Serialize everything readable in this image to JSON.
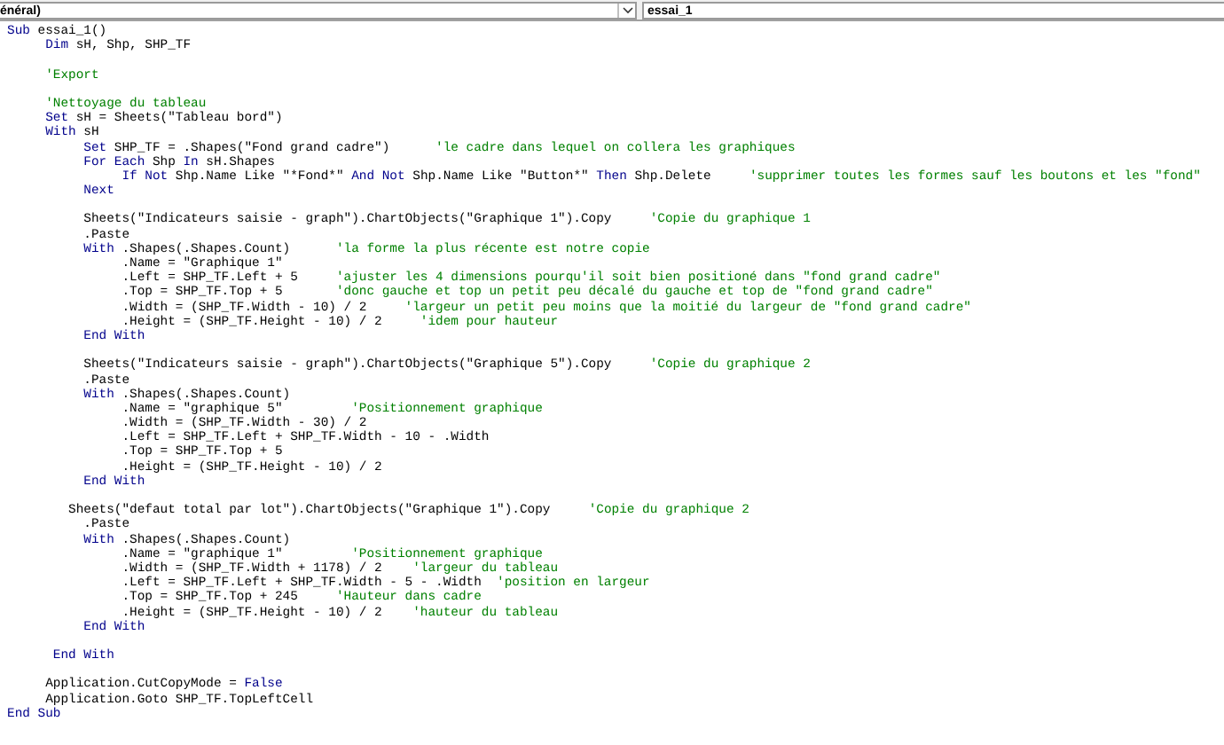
{
  "toolbar": {
    "object_box": {
      "value": "énéral)"
    },
    "procedure_box": {
      "value": "essai_1"
    }
  },
  "code_lines": [
    {
      "kind": "code",
      "parts": [
        {
          "kind": "keyword",
          "text": "Sub"
        },
        {
          "kind": "plain",
          "text": " essai_1()"
        }
      ]
    },
    {
      "kind": "code",
      "parts": [
        {
          "kind": "keyword",
          "text": "     Dim"
        },
        {
          "kind": "plain",
          "text": " sH, Shp, SHP_TF"
        }
      ]
    },
    {
      "kind": "blank"
    },
    {
      "kind": "code",
      "parts": [
        {
          "kind": "comment",
          "text": "     'Export"
        }
      ]
    },
    {
      "kind": "blank"
    },
    {
      "kind": "code",
      "parts": [
        {
          "kind": "comment",
          "text": "     'Nettoyage du tableau"
        }
      ]
    },
    {
      "kind": "code",
      "parts": [
        {
          "kind": "keyword",
          "text": "     Set"
        },
        {
          "kind": "plain",
          "text": " sH = Sheets(\"Tableau bord\")"
        }
      ]
    },
    {
      "kind": "code",
      "parts": [
        {
          "kind": "keyword",
          "text": "     With"
        },
        {
          "kind": "plain",
          "text": " sH"
        }
      ]
    },
    {
      "kind": "code",
      "parts": [
        {
          "kind": "keyword",
          "text": "          Set"
        },
        {
          "kind": "plain",
          "text": " SHP_TF = .Shapes(\"Fond grand cadre\")      "
        },
        {
          "kind": "comment",
          "text": "'le cadre dans lequel on collera les graphiques"
        }
      ]
    },
    {
      "kind": "code",
      "parts": [
        {
          "kind": "keyword",
          "text": "          For Each"
        },
        {
          "kind": "plain",
          "text": " Shp "
        },
        {
          "kind": "keyword",
          "text": "In"
        },
        {
          "kind": "plain",
          "text": " sH.Shapes"
        }
      ]
    },
    {
      "kind": "code",
      "parts": [
        {
          "kind": "keyword",
          "text": "               If Not"
        },
        {
          "kind": "plain",
          "text": " Shp.Name Like \"*Fond*\" "
        },
        {
          "kind": "keyword",
          "text": "And Not"
        },
        {
          "kind": "plain",
          "text": " Shp.Name Like \"Button*\" "
        },
        {
          "kind": "keyword",
          "text": "Then"
        },
        {
          "kind": "plain",
          "text": " Shp.Delete     "
        },
        {
          "kind": "comment",
          "text": "'supprimer toutes les formes sauf les boutons et les \"fond\""
        }
      ]
    },
    {
      "kind": "code",
      "parts": [
        {
          "kind": "keyword",
          "text": "          Next"
        }
      ]
    },
    {
      "kind": "blank"
    },
    {
      "kind": "code",
      "parts": [
        {
          "kind": "plain",
          "text": "          Sheets(\"Indicateurs saisie - graph\").ChartObjects(\"Graphique 1\").Copy     "
        },
        {
          "kind": "comment",
          "text": "'Copie du graphique 1"
        }
      ]
    },
    {
      "kind": "code",
      "parts": [
        {
          "kind": "plain",
          "text": "          .Paste"
        }
      ]
    },
    {
      "kind": "code",
      "parts": [
        {
          "kind": "keyword",
          "text": "          With"
        },
        {
          "kind": "plain",
          "text": " .Shapes(.Shapes.Count)      "
        },
        {
          "kind": "comment",
          "text": "'la forme la plus récente est notre copie"
        }
      ]
    },
    {
      "kind": "code",
      "parts": [
        {
          "kind": "plain",
          "text": "               .Name = \"Graphique 1\""
        }
      ]
    },
    {
      "kind": "code",
      "parts": [
        {
          "kind": "plain",
          "text": "               .Left = SHP_TF.Left + 5     "
        },
        {
          "kind": "comment",
          "text": "'ajuster les 4 dimensions pourqu'il soit bien positioné dans \"fond grand cadre\""
        }
      ]
    },
    {
      "kind": "code",
      "parts": [
        {
          "kind": "plain",
          "text": "               .Top = SHP_TF.Top + 5       "
        },
        {
          "kind": "comment",
          "text": "'donc gauche et top un petit peu décalé du gauche et top de \"fond grand cadre\""
        }
      ]
    },
    {
      "kind": "code",
      "parts": [
        {
          "kind": "plain",
          "text": "               .Width = (SHP_TF.Width - 10) / 2     "
        },
        {
          "kind": "comment",
          "text": "'largeur un petit peu moins que la moitié du largeur de \"fond grand cadre\""
        }
      ]
    },
    {
      "kind": "code",
      "parts": [
        {
          "kind": "plain",
          "text": "               .Height = (SHP_TF.Height - 10) / 2     "
        },
        {
          "kind": "comment",
          "text": "'idem pour hauteur"
        }
      ]
    },
    {
      "kind": "code",
      "parts": [
        {
          "kind": "keyword",
          "text": "          End With"
        }
      ]
    },
    {
      "kind": "blank"
    },
    {
      "kind": "code",
      "parts": [
        {
          "kind": "plain",
          "text": "          Sheets(\"Indicateurs saisie - graph\").ChartObjects(\"Graphique 5\").Copy     "
        },
        {
          "kind": "comment",
          "text": "'Copie du graphique 2"
        }
      ]
    },
    {
      "kind": "code",
      "parts": [
        {
          "kind": "plain",
          "text": "          .Paste"
        }
      ]
    },
    {
      "kind": "code",
      "parts": [
        {
          "kind": "keyword",
          "text": "          With"
        },
        {
          "kind": "plain",
          "text": " .Shapes(.Shapes.Count)"
        }
      ]
    },
    {
      "kind": "code",
      "parts": [
        {
          "kind": "plain",
          "text": "               .Name = \"graphique 5\"         "
        },
        {
          "kind": "comment",
          "text": "'Positionnement graphique"
        }
      ]
    },
    {
      "kind": "code",
      "parts": [
        {
          "kind": "plain",
          "text": "               .Width = (SHP_TF.Width - 30) / 2"
        }
      ]
    },
    {
      "kind": "code",
      "parts": [
        {
          "kind": "plain",
          "text": "               .Left = SHP_TF.Left + SHP_TF.Width - 10 - .Width"
        }
      ]
    },
    {
      "kind": "code",
      "parts": [
        {
          "kind": "plain",
          "text": "               .Top = SHP_TF.Top + 5"
        }
      ]
    },
    {
      "kind": "code",
      "parts": [
        {
          "kind": "plain",
          "text": "               .Height = (SHP_TF.Height - 10) / 2"
        }
      ]
    },
    {
      "kind": "code",
      "parts": [
        {
          "kind": "keyword",
          "text": "          End With"
        }
      ]
    },
    {
      "kind": "blank"
    },
    {
      "kind": "code",
      "parts": [
        {
          "kind": "plain",
          "text": "        Sheets(\"defaut total par lot\").ChartObjects(\"Graphique 1\").Copy     "
        },
        {
          "kind": "comment",
          "text": "'Copie du graphique 2"
        }
      ]
    },
    {
      "kind": "code",
      "parts": [
        {
          "kind": "plain",
          "text": "          .Paste"
        }
      ]
    },
    {
      "kind": "code",
      "parts": [
        {
          "kind": "keyword",
          "text": "          With"
        },
        {
          "kind": "plain",
          "text": " .Shapes(.Shapes.Count)"
        }
      ]
    },
    {
      "kind": "code",
      "parts": [
        {
          "kind": "plain",
          "text": "               .Name = \"graphique 1\"         "
        },
        {
          "kind": "comment",
          "text": "'Positionnement graphique"
        }
      ]
    },
    {
      "kind": "code",
      "parts": [
        {
          "kind": "plain",
          "text": "               .Width = (SHP_TF.Width + 1178) / 2    "
        },
        {
          "kind": "comment",
          "text": "'largeur du tableau"
        }
      ]
    },
    {
      "kind": "code",
      "parts": [
        {
          "kind": "plain",
          "text": "               .Left = SHP_TF.Left + SHP_TF.Width - 5 - .Width  "
        },
        {
          "kind": "comment",
          "text": "'position en largeur"
        }
      ]
    },
    {
      "kind": "code",
      "parts": [
        {
          "kind": "plain",
          "text": "               .Top = SHP_TF.Top + 245     "
        },
        {
          "kind": "comment",
          "text": "'Hauteur dans cadre"
        }
      ]
    },
    {
      "kind": "code",
      "parts": [
        {
          "kind": "plain",
          "text": "               .Height = (SHP_TF.Height - 10) / 2    "
        },
        {
          "kind": "comment",
          "text": "'hauteur du tableau"
        }
      ]
    },
    {
      "kind": "code",
      "parts": [
        {
          "kind": "keyword",
          "text": "          End With"
        }
      ]
    },
    {
      "kind": "blank"
    },
    {
      "kind": "code",
      "parts": [
        {
          "kind": "keyword",
          "text": "      End With"
        }
      ]
    },
    {
      "kind": "blank"
    },
    {
      "kind": "code",
      "parts": [
        {
          "kind": "plain",
          "text": "     Application.CutCopyMode = "
        },
        {
          "kind": "keyword",
          "text": "False"
        }
      ]
    },
    {
      "kind": "code",
      "parts": [
        {
          "kind": "plain",
          "text": "     Application.Goto SHP_TF.TopLeftCell"
        }
      ]
    },
    {
      "kind": "code",
      "parts": [
        {
          "kind": "keyword",
          "text": "End Sub"
        }
      ]
    }
  ]
}
